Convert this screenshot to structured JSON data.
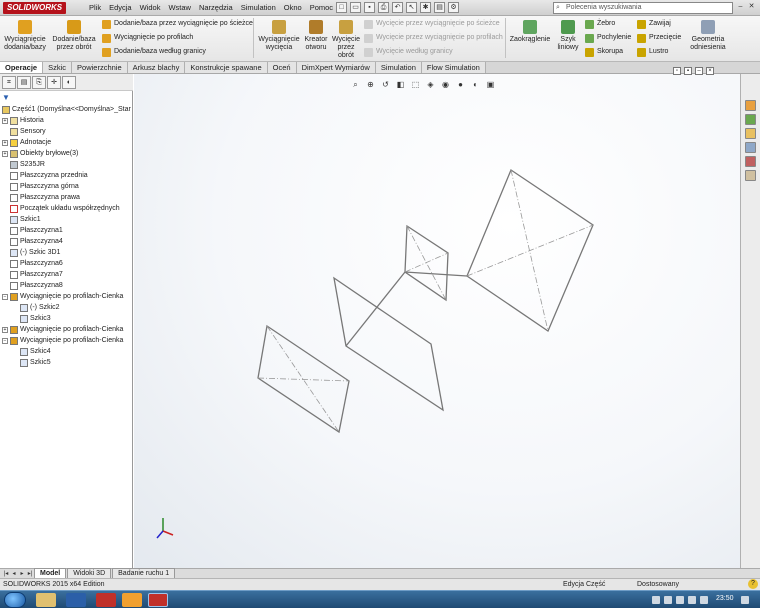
{
  "app": {
    "logo_text": "SOLIDWORKS"
  },
  "menu": [
    "Plik",
    "Edycja",
    "Widok",
    "Wstaw",
    "Narzędzia",
    "Simulation",
    "Okno",
    "Pomoc"
  ],
  "search": {
    "placeholder": "Polecenia wyszukiwania"
  },
  "ribbon": {
    "extrude_boss": "Wyciągnięcie dodania/bazy",
    "revolve_boss": "Dodanie/baza przez obrót",
    "swept_boss": "Dodanie/baza przez wyciągnięcie po ścieżce",
    "lofted_boss": "Wyciągnięcie po profilach",
    "boundary_boss": "Dodanie/baza według granicy",
    "extruded_cut": "Wyciągnięcie wycięcia",
    "hole_wizard": "Kreator otworu",
    "revolved_cut": "Wycięcie przez obrót",
    "swept_cut": "Wycięcie przez wyciągnięcie po ścieżce",
    "lofted_cut": "Wycięcie przez wyciągnięcie po profilach",
    "boundary_cut": "Wycięcie według granicy",
    "fillet": "Zaokrąglenie",
    "linear_pattern": "Szyk liniowy",
    "rib": "Żebro",
    "draft": "Pochylenie",
    "shell": "Skorupa",
    "wrap": "Zawijaj",
    "intersect": "Przecięcie",
    "mirror": "Lustro",
    "ref_geometry": "Geometria odniesienia"
  },
  "tabs": [
    "Operacje",
    "Szkic",
    "Powierzchnie",
    "Arkusz blachy",
    "Konstrukcje spawane",
    "Oceń",
    "DimXpert Wymiarów",
    "Simulation",
    "Flow Simulation"
  ],
  "tree": [
    {
      "label": "Część1  (Domyślna<<Domyślna>_Star"
    },
    {
      "label": "Historia"
    },
    {
      "label": "Sensory"
    },
    {
      "label": "Adnotacje"
    },
    {
      "label": "Obiekty bryłowe(3)"
    },
    {
      "label": "S235JR"
    },
    {
      "label": "Płaszczyzna przednia"
    },
    {
      "label": "Płaszczyzna górna"
    },
    {
      "label": "Płaszczyzna prawa"
    },
    {
      "label": "Początek układu współrzędnych"
    },
    {
      "label": "Szkic1"
    },
    {
      "label": "Płaszczyzna1"
    },
    {
      "label": "Płaszczyzna4"
    },
    {
      "label": "(-) Szkic 3D1"
    },
    {
      "label": "Płaszczyzna6"
    },
    {
      "label": "Płaszczyzna7"
    },
    {
      "label": "Płaszczyzna8"
    },
    {
      "label": "Wyciągnięcie po profilach-Cienka"
    },
    {
      "label": "(-) Szkic2"
    },
    {
      "label": "Szkic3"
    },
    {
      "label": "Wyciągnięcie po profilach-Cienka"
    },
    {
      "label": "Wyciągnięcie po profilach-Cienka"
    },
    {
      "label": "Szkic4"
    },
    {
      "label": "Szkic5"
    }
  ],
  "model_tabs": [
    "Model",
    "Widoki 3D",
    "Badanie ruchu 1"
  ],
  "status": {
    "left": "SOLIDWORKS 2015 x64 Edition",
    "mode": "Edycja Część",
    "custom": "Dostosowany",
    "help": "?"
  },
  "taskbar": {
    "clock": "23:50"
  },
  "colors": {
    "logo": "#b5121b",
    "tab_bg": "#e4e4e4",
    "viewport": "#f2f5f8",
    "taskbar": "#2a5a86"
  }
}
